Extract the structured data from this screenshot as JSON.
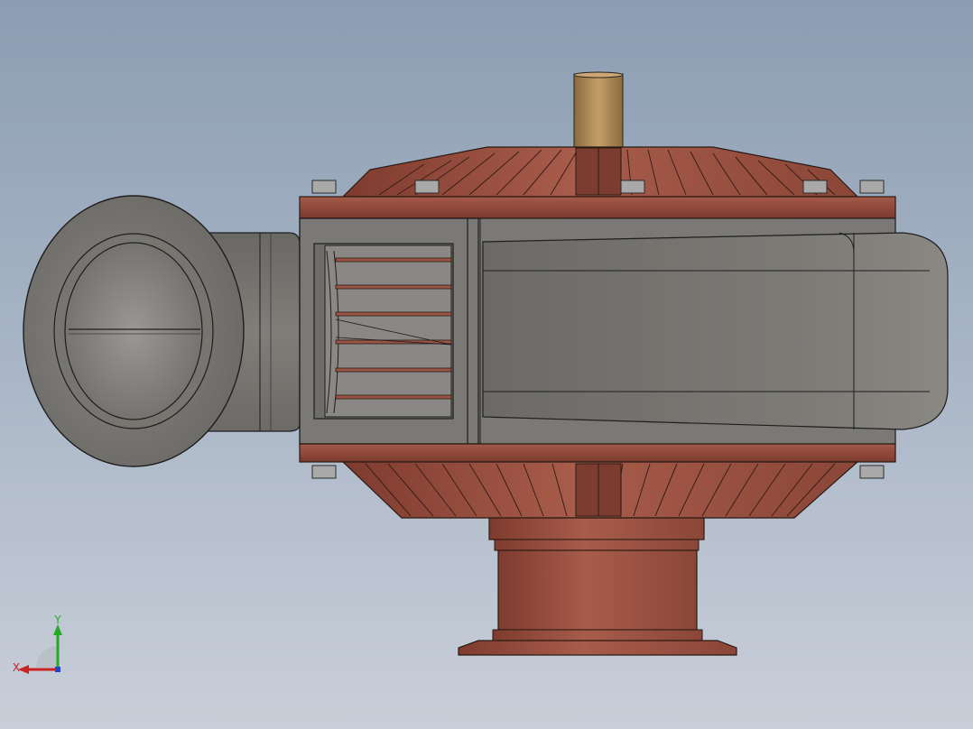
{
  "view": {
    "background_top": "#8c9db3",
    "background_bottom": "#c9cfd9"
  },
  "model": {
    "casing_color": "#7a7874",
    "housing_color": "#9a5546",
    "shaft_color": "#b08a55",
    "bolt_color": "#a8a8a8"
  },
  "triad": {
    "x_label": "X",
    "y_label": "Y",
    "x_color": "#cc2222",
    "y_color": "#22aa22",
    "z_color": "#2244cc"
  }
}
